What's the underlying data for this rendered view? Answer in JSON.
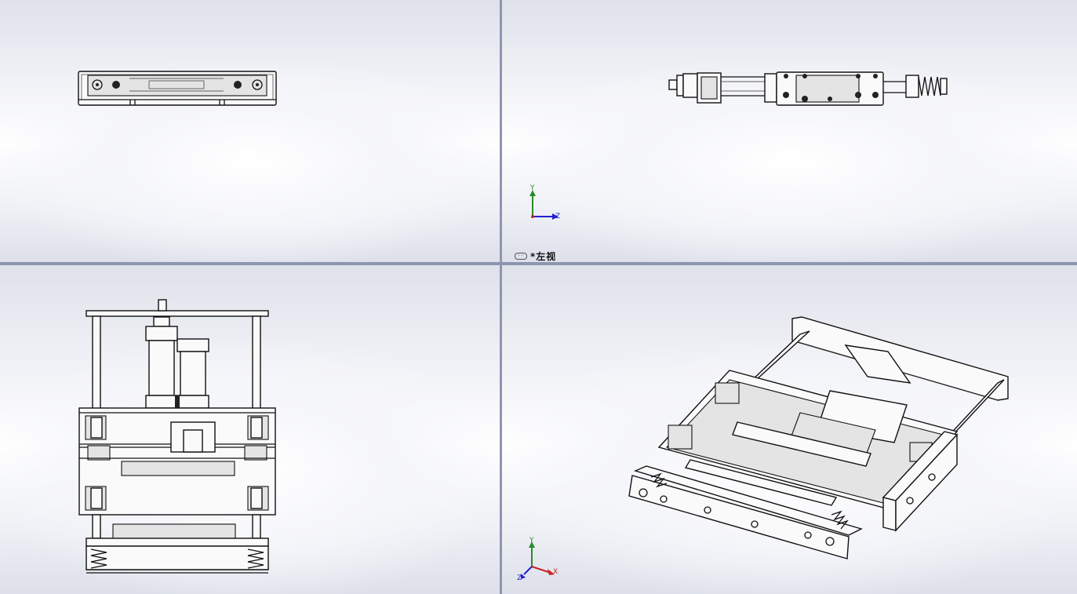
{
  "viewports": {
    "top_left": {
      "name": "front-view"
    },
    "top_right": {
      "name": "left-view",
      "label": "*左视"
    },
    "bottom_left": {
      "name": "top-view"
    },
    "bottom_right": {
      "name": "isometric-view"
    }
  },
  "triad": {
    "left_view": {
      "y": "Y",
      "z": "Z"
    },
    "iso_view": {
      "y": "Y",
      "x": "X",
      "z": "Z"
    }
  },
  "colors": {
    "y_axis": "#2a8a2a",
    "z_axis": "#2222cc",
    "x_axis": "#cc2222"
  }
}
